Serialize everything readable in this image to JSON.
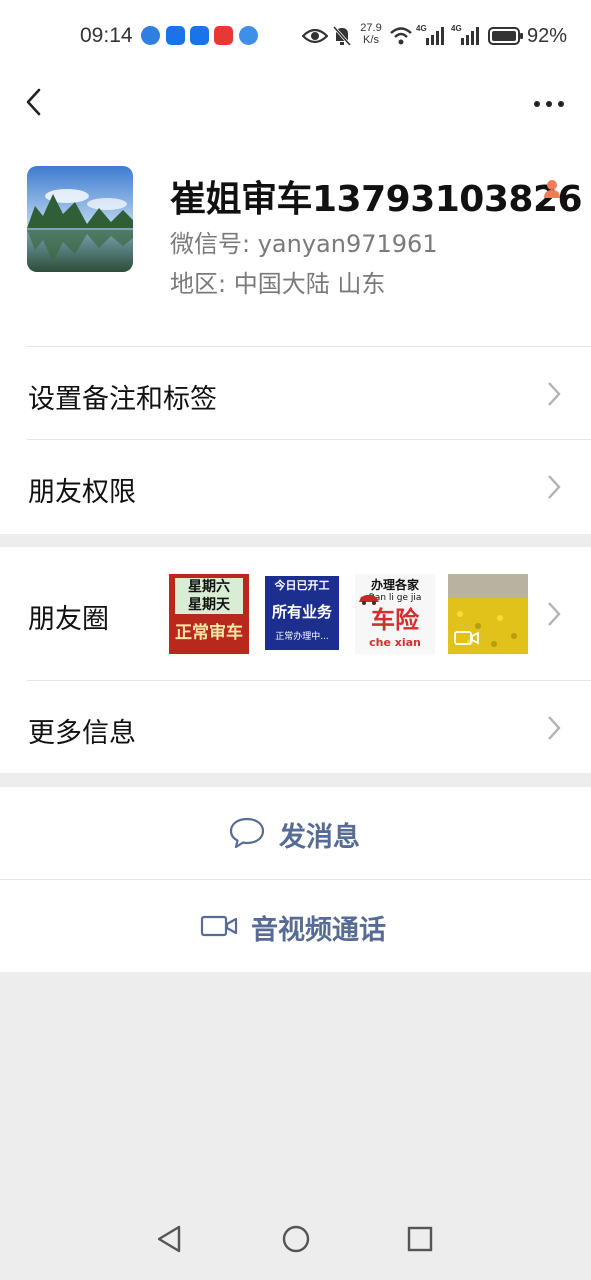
{
  "status_bar": {
    "time": "09:14",
    "speed_value": "27.9",
    "speed_unit": "K/s",
    "network_1": "4G",
    "network_2": "4G",
    "battery_percent": "92%",
    "app_icons": [
      "browser-icon",
      "bulb-icon",
      "search-app-icon",
      "book-app-icon",
      "cloud-app-icon"
    ],
    "app_colors": [
      "#2f7fe0",
      "#1a73e8",
      "#1a73e8",
      "#e53935",
      "#3d8fe8"
    ]
  },
  "profile": {
    "name": "崔姐审车13793103826",
    "wechat_id": "微信号: yanyan971961",
    "region": "地区: 中国大陆  山东"
  },
  "rows": {
    "remark_label": "设置备注和标签",
    "permissions_label": "朋友权限",
    "moments_label": "朋友圈",
    "more_info_label": "更多信息"
  },
  "moments": {
    "thumb1": {
      "line1": "星期六",
      "line2": "星期天",
      "line3": "正常审车"
    },
    "thumb2": {
      "line1": "今日已开工",
      "line2": "所有业务",
      "line3": "正常办理中..."
    },
    "thumb3": {
      "line1": "办理各家",
      "line2": "Ban li ge jia",
      "line3": "车险",
      "line4": "che xian"
    }
  },
  "actions": {
    "message_label": "发消息",
    "call_label": "音视频通话"
  },
  "colors": {
    "link": "#576b95",
    "background": "#ededed",
    "gender": "#f07c58"
  }
}
